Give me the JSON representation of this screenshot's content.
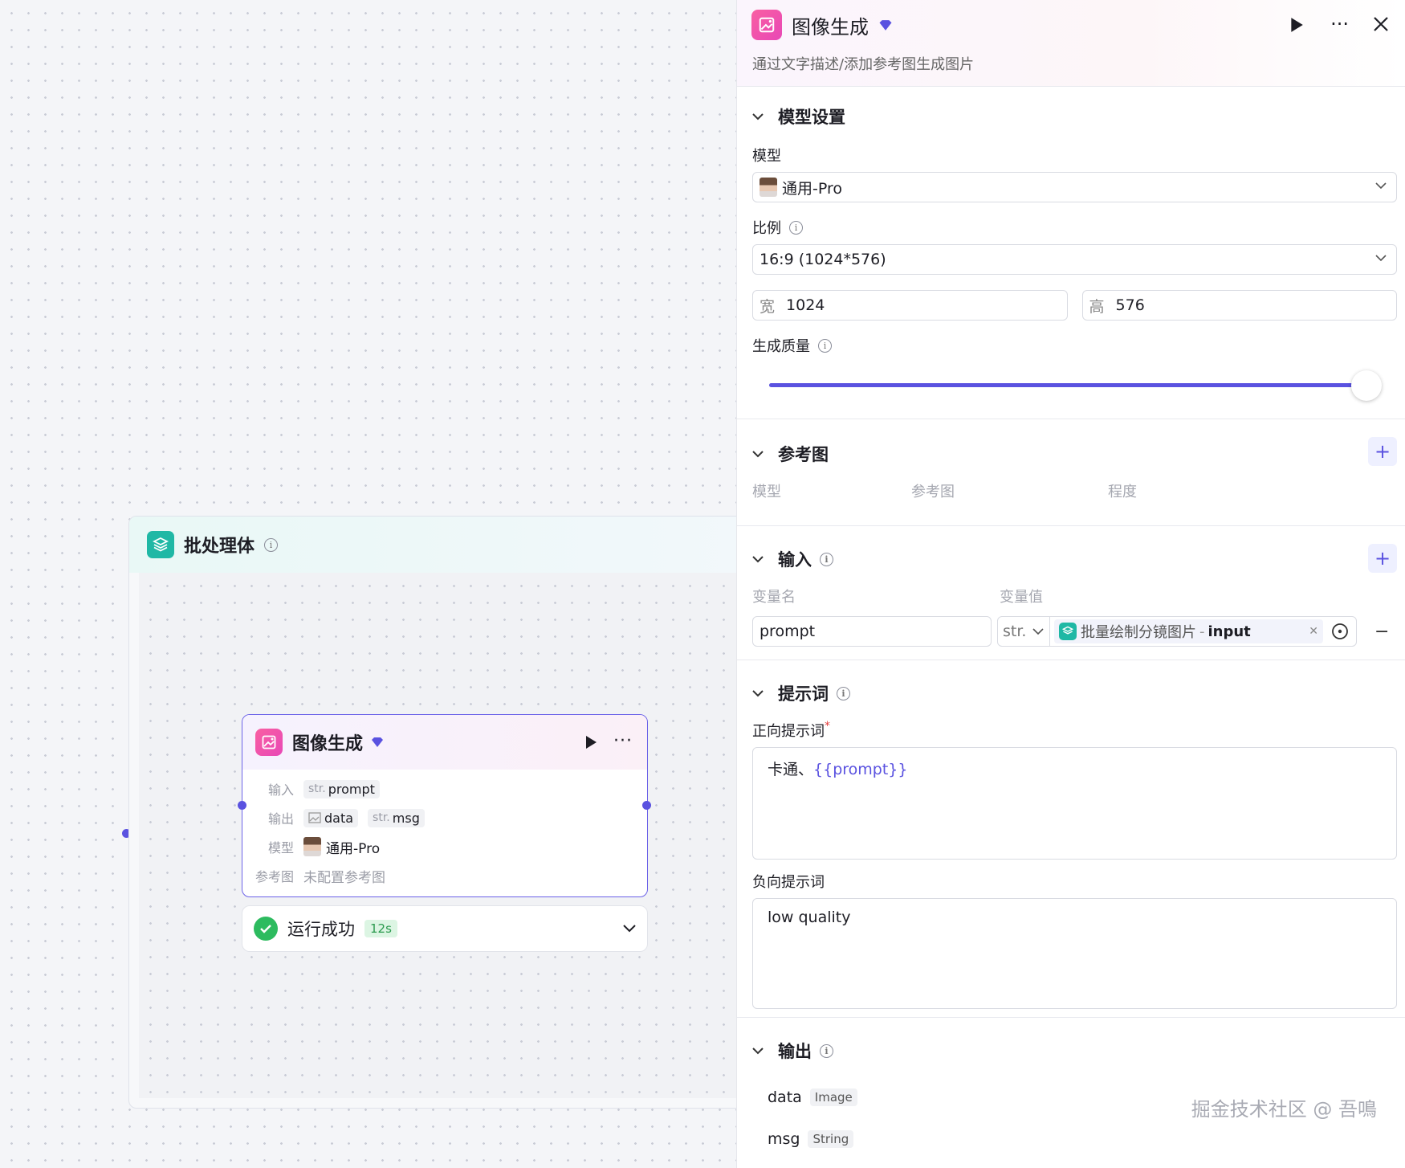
{
  "canvas": {
    "batch": {
      "title": "批处理体"
    },
    "node": {
      "title": "图像生成",
      "rows": [
        {
          "label": "输入",
          "tags": [
            {
              "type": "str.",
              "name": "prompt"
            }
          ]
        },
        {
          "label": "输出",
          "tags": [
            {
              "icon": "image",
              "name": "data"
            },
            {
              "type": "str.",
              "name": "msg"
            }
          ]
        },
        {
          "label": "模型",
          "value": "通用-Pro"
        },
        {
          "label": "参考图",
          "value": "未配置参考图"
        }
      ]
    },
    "status": {
      "text": "运行成功",
      "time": "12s"
    }
  },
  "panel": {
    "title": "图像生成",
    "desc": "通过文字描述/添加参考图生成图片",
    "model_section": {
      "title": "模型设置",
      "model_label": "模型",
      "model_value": "通用-Pro",
      "ratio_label": "比例",
      "ratio_value": "16:9 (1024*576)",
      "width_label": "宽",
      "width_value": "1024",
      "height_label": "高",
      "height_value": "576",
      "quality_label": "生成质量",
      "quality_level": 1.0
    },
    "ref_section": {
      "title": "参考图",
      "cols": [
        "模型",
        "参考图",
        "程度"
      ]
    },
    "input_section": {
      "title": "输入",
      "cols": [
        "变量名",
        "变量值"
      ],
      "var_name": "prompt",
      "var_type": "str.",
      "var_ref": "批量绘制分镜图片",
      "var_ref_field": "input",
      "sep": "-"
    },
    "prompt_section": {
      "title": "提示词",
      "positive_label": "正向提示词",
      "required": "*",
      "positive_text": "卡通、",
      "positive_var": "{{prompt}}",
      "negative_label": "负向提示词",
      "negative_text": "low quality"
    },
    "output_section": {
      "title": "输出",
      "items": [
        {
          "name": "data",
          "type": "Image"
        },
        {
          "name": "msg",
          "type": "String"
        }
      ]
    }
  },
  "watermark": "掘金技术社区 @ 吾鳴",
  "colors": {
    "accent": "#5a52e0",
    "teal": "#1fb8a5",
    "pink": "#f0509f",
    "success": "#2dbb5f"
  }
}
